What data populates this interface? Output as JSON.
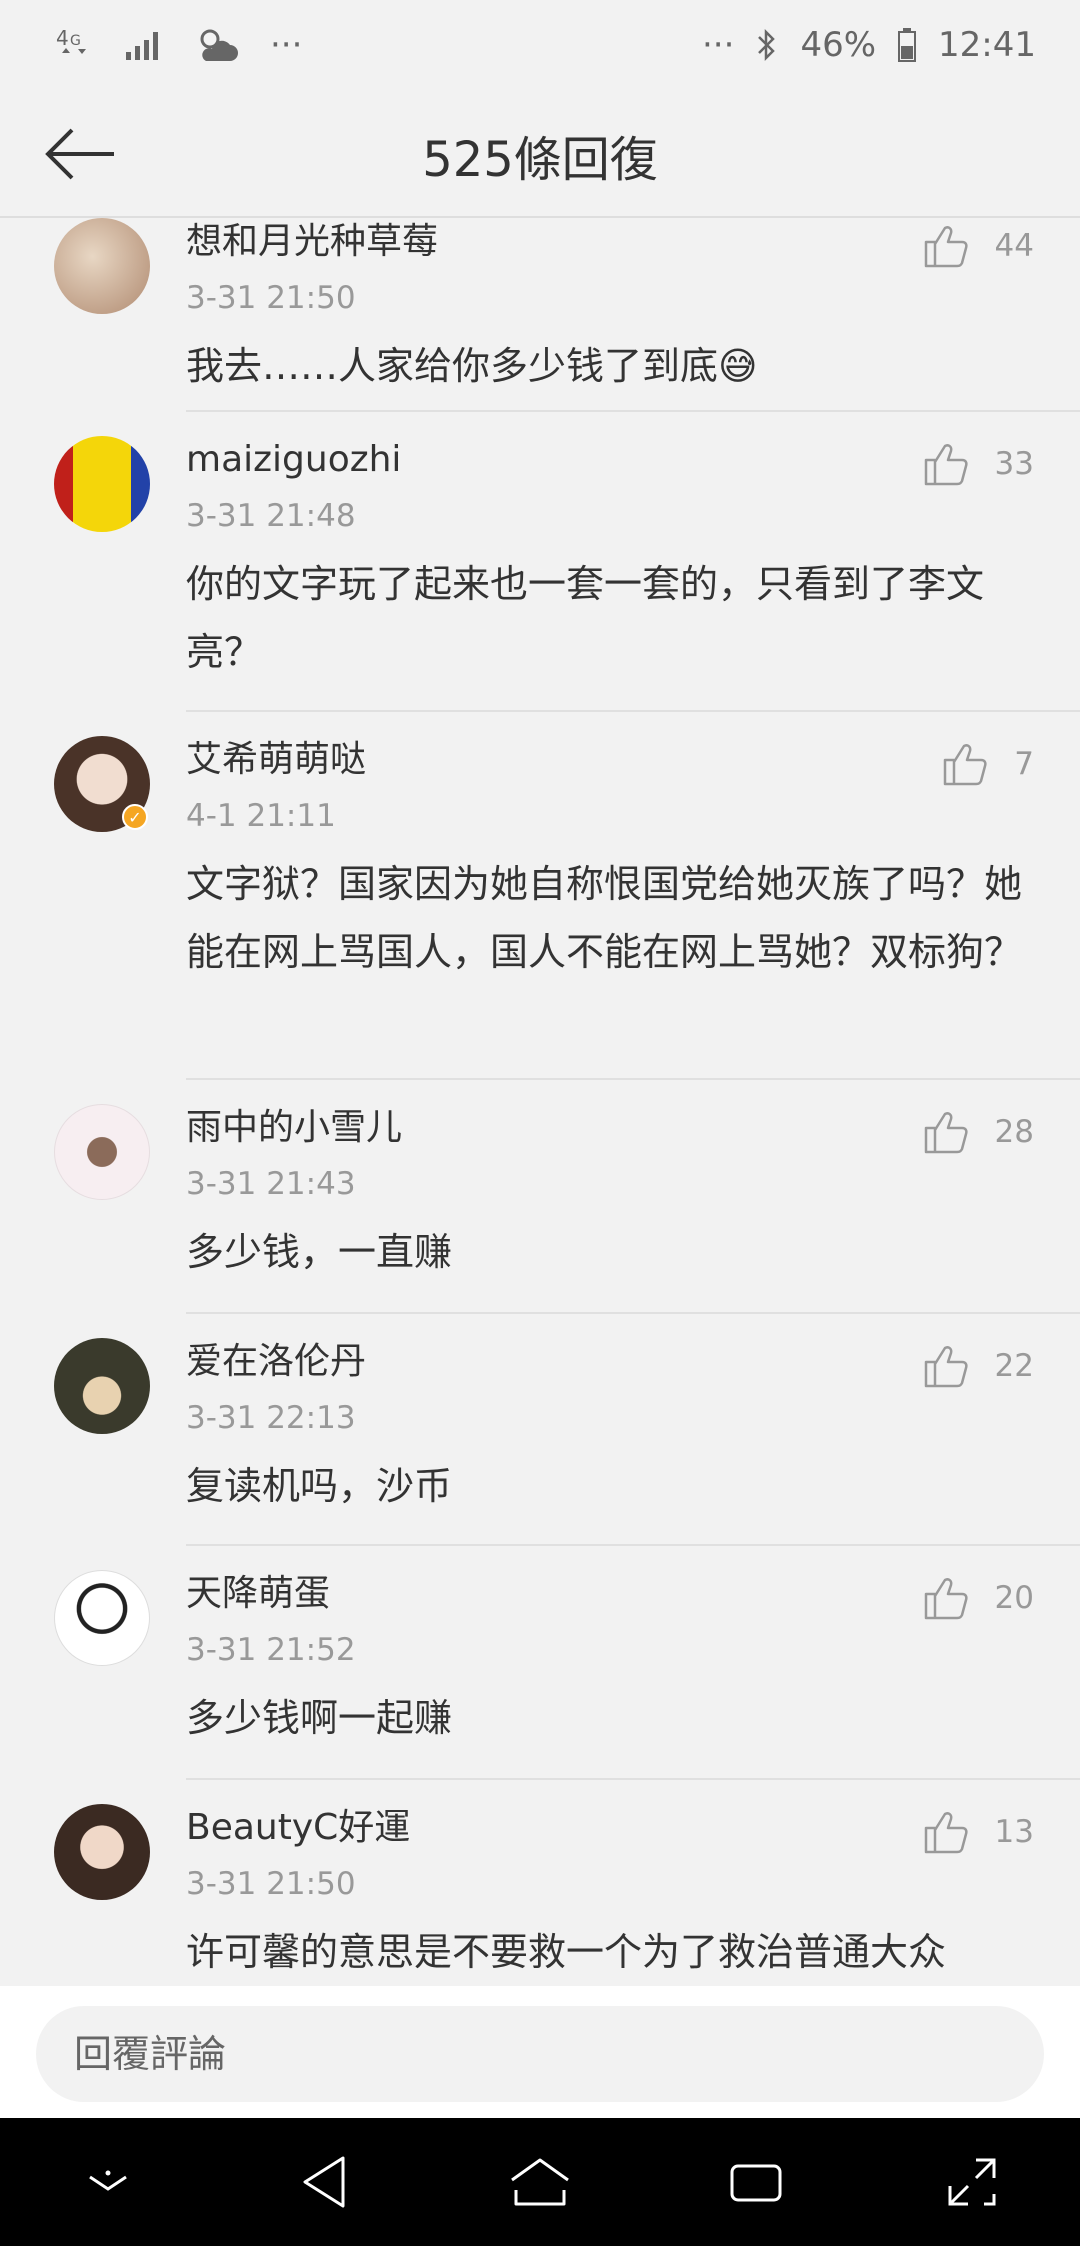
{
  "status_bar": {
    "network": "4G",
    "more_left": "···",
    "more_right": "···",
    "battery_percent": "46%",
    "time": "12:41"
  },
  "header": {
    "title": "525條回復",
    "back_icon": "back-arrow-icon"
  },
  "comments": [
    {
      "user": "想和月光种草莓",
      "time": "3-31 21:50",
      "text": "我去……人家给你多少钱了到底😅",
      "likes": "44",
      "avatar_color": "#c9a98a"
    },
    {
      "user": "maiziguozhi",
      "time": "3-31 21:48",
      "text": "你的文字玩了起来也一套一套的，只看到了李文亮？",
      "likes": "33",
      "avatar_color": "#f4d60a"
    },
    {
      "user": "艾希萌萌哒",
      "time": "4-1 21:11",
      "text": "文字狱？国家因为她自称恨国党给她灭族了吗？她能在网上骂国人，国人不能在网上骂她？双标狗？",
      "likes": "7",
      "avatar_color": "#8a6a5a"
    },
    {
      "user": "雨中的小雪儿",
      "time": "3-31 21:43",
      "text": "多少钱，一直赚",
      "likes": "28",
      "avatar_color": "#f4eef0"
    },
    {
      "user": "爱在洛伦丹",
      "time": "3-31 22:13",
      "text": "复读机吗，沙币",
      "likes": "22",
      "avatar_color": "#4a4a3a"
    },
    {
      "user": "天降萌蛋",
      "time": "3-31 21:52",
      "text": "多少钱啊一起赚",
      "likes": "20",
      "avatar_color": "#ffffff"
    },
    {
      "user": "BeautyC好運",
      "time": "3-31 21:50",
      "text": "许可馨的意思是不要救一个为了救治普通大众",
      "likes": "13",
      "avatar_color": "#d8c0b0"
    }
  ],
  "reply": {
    "placeholder": "回覆評論"
  },
  "colors": {
    "background": "#f2f2f2",
    "text": "#333333",
    "muted": "#999999",
    "verified": "#f5a623"
  }
}
